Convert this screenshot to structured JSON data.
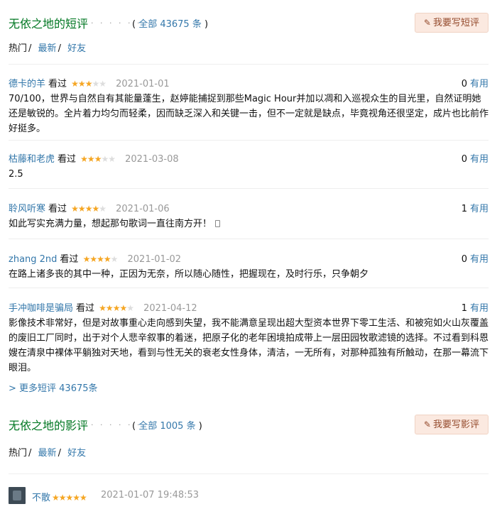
{
  "short_comments": {
    "title": "无依之地的短评",
    "dots": "· · · · · ·",
    "count_prefix": "( ",
    "count_link": "全部 43675 条",
    "count_suffix": " )",
    "write_button": "我要写短评",
    "tabs": {
      "hot": "热门",
      "latest": "最新",
      "friends": "好友",
      "sep": "/"
    },
    "comments": [
      {
        "user": "德卡的羊",
        "watched": "看过",
        "rating": 3,
        "time": "2021-01-01",
        "useful_count": "0",
        "useful_label": "有用",
        "text": "70/100，世界与自然自有其能量蓬生，赵婷能捕捉到那些Magic Hour并加以凋和入巡视众生的目光里，自然证明她还是敏锐的。全片着力均匀而轻柔，因而缺乏深入和关键一击，但不一定就是缺点，毕竟视角还很坚定，成片也比前作好挺多。"
      },
      {
        "user": "枯藤和老虎",
        "watched": "看过",
        "rating": 3,
        "time": "2021-03-08",
        "useful_count": "0",
        "useful_label": "有用",
        "text": "2.5"
      },
      {
        "user": "聆风听寒",
        "watched": "看过",
        "rating": 4,
        "time": "2021-01-06",
        "useful_count": "1",
        "useful_label": "有用",
        "text": "如此写实充满力量，想起那句歌词一直往南方开！"
      },
      {
        "user": "zhang 2nd",
        "watched": "看过",
        "rating": 4,
        "time": "2021-01-02",
        "useful_count": "0",
        "useful_label": "有用",
        "text": "在路上诸多丧的其中一种，正因为无奈，所以随心随性，把握现在，及时行乐，只争朝夕"
      },
      {
        "user": "手冲咖啡是骗局",
        "watched": "看过",
        "rating": 4,
        "time": "2021-04-12",
        "useful_count": "1",
        "useful_label": "有用",
        "text": "影像技术非常好，但是对故事重心走向感到失望，我不能满意呈现出超大型资本世界下零工生活、和被宛如火山灰覆盖的废旧工厂同时，出于对个人悲辛叙事的着迷，把原子化的老年困境拍成带上一层田园牧歌滤镜的选择。不过看到科恩嫂在清泉中裸体平躺独对天地，看到与性无关的衰老女性身体，清洁，一无所有，对那种孤独有所触动，在那一幕流下眼泪。"
      }
    ],
    "more_link": "> 更多短评 43675条"
  },
  "reviews": {
    "title": "无依之地的影评",
    "dots": "· · · · · ·",
    "count_prefix": "( ",
    "count_link": "全部 1005 条",
    "count_suffix": " )",
    "write_button": "我要写影评",
    "tabs": {
      "hot": "热门",
      "latest": "最新",
      "friends": "好友",
      "sep": "/"
    },
    "first_review": {
      "user": "不散",
      "rating": 5,
      "time": "2021-01-07 19:48:53"
    }
  },
  "colors": {
    "green_title": "#007722",
    "link_blue": "#3377aa",
    "star": "#f5a623",
    "button_bg": "#fbe9e0"
  }
}
